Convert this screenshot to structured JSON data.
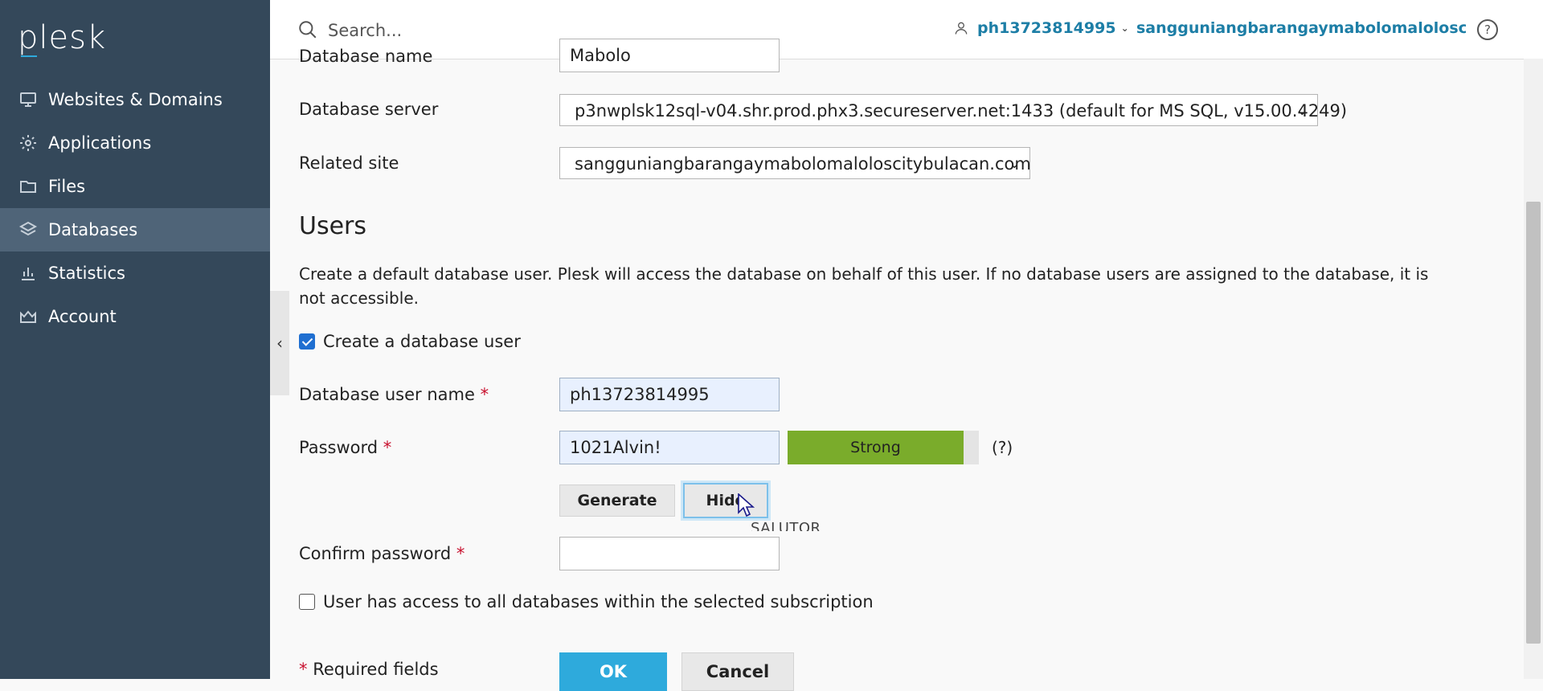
{
  "sidebar": {
    "logo": "plesk",
    "items": [
      {
        "label": "Websites & Domains",
        "icon": "monitor-icon",
        "active": false
      },
      {
        "label": "Applications",
        "icon": "gear-icon",
        "active": false
      },
      {
        "label": "Files",
        "icon": "folder-icon",
        "active": false
      },
      {
        "label": "Databases",
        "icon": "layers-icon",
        "active": true
      },
      {
        "label": "Statistics",
        "icon": "bar-chart-icon",
        "active": false
      },
      {
        "label": "Account",
        "icon": "crown-icon",
        "active": false
      }
    ],
    "collapse_glyph": "‹"
  },
  "header": {
    "search_placeholder": "Search...",
    "user": "ph13723814995",
    "domain": "sangguniangbarangaymabolomalolosci...",
    "help": "?"
  },
  "form": {
    "database_name_label": "Database name",
    "database_name_value": "Mabolo",
    "database_server_label": "Database server",
    "database_server_value": "p3nwplsk12sql-v04.shr.prod.phx3.secureserver.net:1433 (default for MS SQL, v15.00.4249)",
    "related_site_label": "Related site",
    "related_site_value": "sangguniangbarangaymabolomaloloscitybulacan.com",
    "users_title": "Users",
    "users_desc": "Create a default database user. Plesk will access the database on behalf of this user. If no database users are assigned to the database, it is not accessible.",
    "create_user_label": "Create a database user",
    "create_user_checked": true,
    "db_user_label": "Database user name",
    "db_user_value": "ph13723814995",
    "password_label": "Password",
    "password_value": "1021Alvin!",
    "strength_label": "Strong",
    "strength_level": 0.92,
    "strength_help": "(?)",
    "generate_label": "Generate",
    "hide_label": "Hide",
    "overlay_text": "SALUTOR",
    "confirm_password_label": "Confirm password",
    "confirm_password_value": "",
    "all_db_access_label": "User has access to all databases within the selected subscription",
    "all_db_access_checked": false,
    "required_note": "Required fields",
    "required_star": "*",
    "ok_label": "OK",
    "cancel_label": "Cancel"
  },
  "colors": {
    "sidebar_bg": "#34485a",
    "active_item": "#4f6478",
    "link": "#1d7ea6",
    "strength_strong": "#7aac2b",
    "primary_button": "#2eaadc",
    "required": "#c8102e"
  }
}
